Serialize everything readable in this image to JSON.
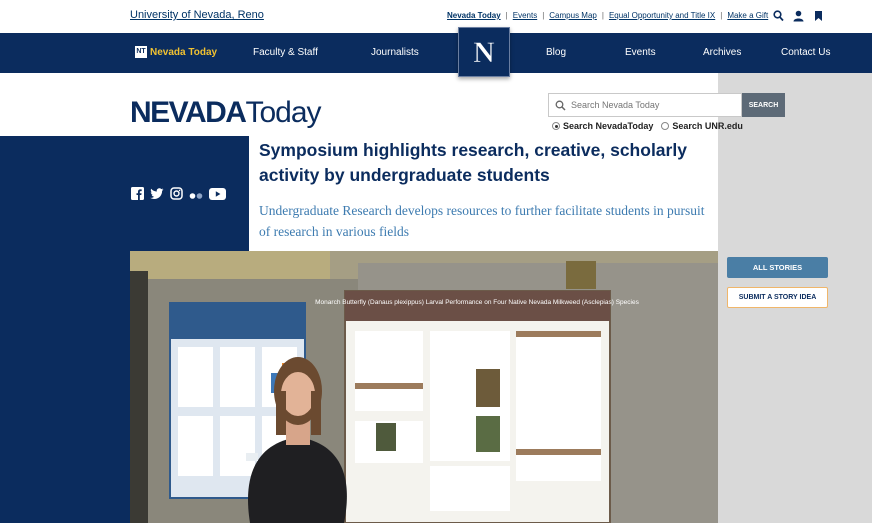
{
  "utility": {
    "university": "University of Nevada, Reno",
    "links": [
      "Nevada Today",
      "Events",
      "Campus Map",
      "Equal Opportunity and Title IX",
      "Make a Gift"
    ],
    "icons": [
      "search-icon",
      "user-icon",
      "bookmark-icon"
    ]
  },
  "nav": {
    "brand_logo": "NT",
    "brand": "Nevada Today",
    "items": [
      "Faculty & Staff",
      "Journalists",
      "Blog",
      "Events",
      "Archives",
      "Contact Us"
    ],
    "n_logo": "N"
  },
  "masthead": {
    "bold": "NEVADA",
    "light": "Today"
  },
  "search": {
    "placeholder": "Search Nevada Today",
    "button": "SEARCH",
    "options": [
      "Search NevadaToday",
      "Search UNR.edu"
    ],
    "selected": "Search NevadaToday"
  },
  "social": [
    "facebook-icon",
    "twitter-icon",
    "instagram-icon",
    "flickr-icon",
    "youtube-icon"
  ],
  "article": {
    "headline": "Symposium highlights research, creative, scholarly activity by undergraduate students",
    "subhead": "Undergraduate Research develops resources to further facilitate students in pursuit of research in various fields"
  },
  "side": {
    "all_stories": "ALL STORIES",
    "submit": "SUBMIT A STORY IDEA"
  },
  "poster": {
    "title": "Monarch Butterfly (Danaus plexippus) Larval Performance on Four Native Nevada Milkweed (Asclepias) Species"
  },
  "colors": {
    "navy": "#0b2c5e",
    "gold": "#f2c231",
    "link_blue": "#3d7bb0"
  }
}
